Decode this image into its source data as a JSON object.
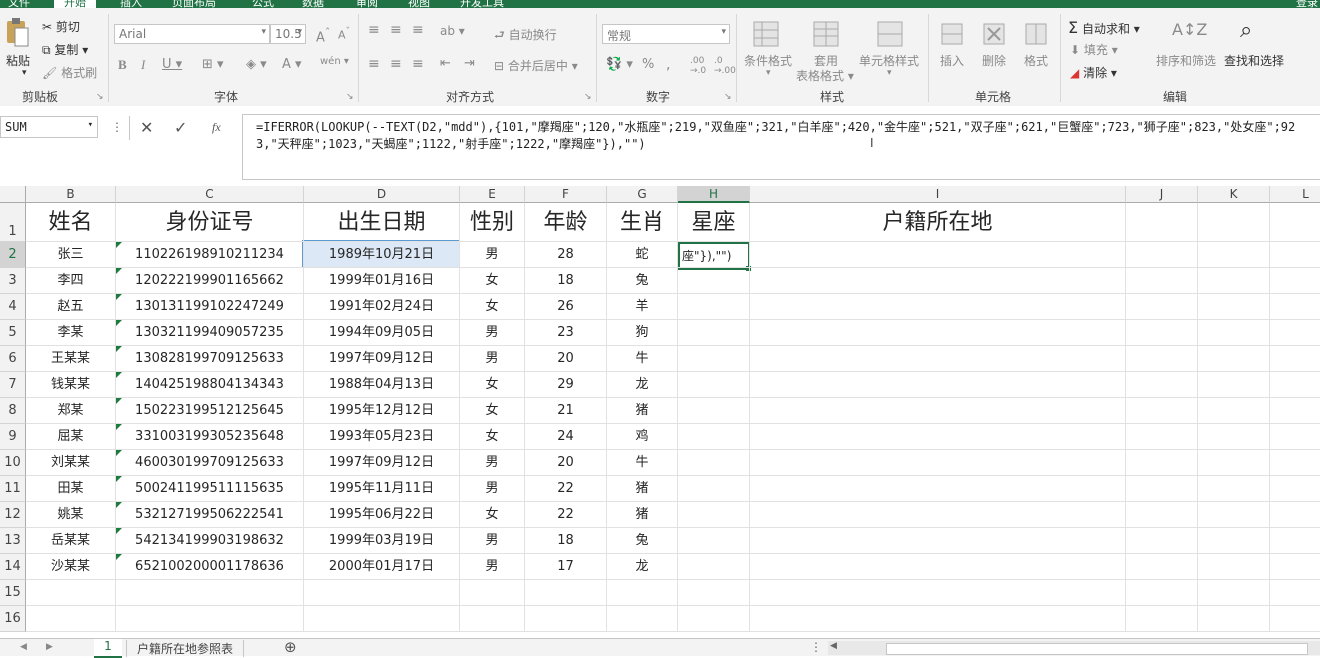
{
  "ribbon_tabs": [
    "文件",
    "开始",
    "插入",
    "页面布局",
    "公式",
    "数据",
    "审阅",
    "视图",
    "开发工具"
  ],
  "user": "登录",
  "clipboard": {
    "paste": "粘贴",
    "cut": "剪切",
    "copy": "复制",
    "format_painter": "格式刷",
    "label": "剪贴板"
  },
  "font": {
    "name": "Arial",
    "size": "10.5",
    "label": "字体"
  },
  "alignment": {
    "wrap": "自动换行",
    "merge": "合并后居中",
    "label": "对齐方式"
  },
  "number": {
    "format": "常规",
    "label": "数字"
  },
  "styles": {
    "conditional": "条件格式",
    "table_fmt_1": "套用",
    "table_fmt_2": "表格格式",
    "cell_styles": "单元格样式",
    "label": "样式"
  },
  "cells": {
    "insert": "插入",
    "delete": "删除",
    "format": "格式",
    "label": "单元格"
  },
  "editing": {
    "autosum": "自动求和",
    "fill": "填充",
    "clear": "清除",
    "sort": "排序和筛选",
    "find": "查找和选择",
    "label": "编辑"
  },
  "name_box": "SUM",
  "formula": "=IFERROR(LOOKUP(--TEXT(D2,\"mdd\"),{101,\"摩羯座\";120,\"水瓶座\";219,\"双鱼座\";321,\"白羊座\";420,\"金牛座\";521,\"双子座\";621,\"巨蟹座\";723,\"狮子座\";823,\"处女座\";923,\"天秤座\";1023,\"天蝎座\";1122,\"射手座\";1222,\"摩羯座\"}),\"\")",
  "columns": [
    "B",
    "C",
    "D",
    "E",
    "F",
    "G",
    "H",
    "I",
    "J",
    "K",
    "L"
  ],
  "headers": [
    "姓名",
    "身份证号",
    "出生日期",
    "性别",
    "年龄",
    "生肖",
    "星座",
    "户籍所在地"
  ],
  "rows": [
    [
      "张三",
      "110226198910211234",
      "1989年10月21日",
      "男",
      "28",
      "蛇"
    ],
    [
      "李四",
      "120222199901165662",
      "1999年01月16日",
      "女",
      "18",
      "兔"
    ],
    [
      "赵五",
      "130131199102247249",
      "1991年02月24日",
      "女",
      "26",
      "羊"
    ],
    [
      "李某",
      "130321199409057235",
      "1994年09月05日",
      "男",
      "23",
      "狗"
    ],
    [
      "王某某",
      "130828199709125633",
      "1997年09月12日",
      "男",
      "20",
      "牛"
    ],
    [
      "钱某某",
      "140425198804134343",
      "1988年04月13日",
      "女",
      "29",
      "龙"
    ],
    [
      "郑某",
      "150223199512125645",
      "1995年12月12日",
      "女",
      "21",
      "猪"
    ],
    [
      "屈某",
      "331003199305235648",
      "1993年05月23日",
      "女",
      "24",
      "鸡"
    ],
    [
      "刘某某",
      "460030199709125633",
      "1997年09月12日",
      "男",
      "20",
      "牛"
    ],
    [
      "田某",
      "500241199511115635",
      "1995年11月11日",
      "男",
      "22",
      "猪"
    ],
    [
      "姚某",
      "532127199506222541",
      "1995年06月22日",
      "女",
      "22",
      "猪"
    ],
    [
      "岳某某",
      "542134199903198632",
      "1999年03月19日",
      "男",
      "18",
      "兔"
    ],
    [
      "沙某某",
      "652100200001178636",
      "2000年01月17日",
      "男",
      "17",
      "龙"
    ]
  ],
  "row_numbers": [
    "1",
    "2",
    "3",
    "4",
    "5",
    "6",
    "7",
    "8",
    "9",
    "10",
    "11",
    "12",
    "13",
    "14",
    "15",
    "16"
  ],
  "editing_cell_text": "座\"}),\"\")",
  "sheet_tabs": [
    "1",
    "户籍所在地参照表"
  ]
}
